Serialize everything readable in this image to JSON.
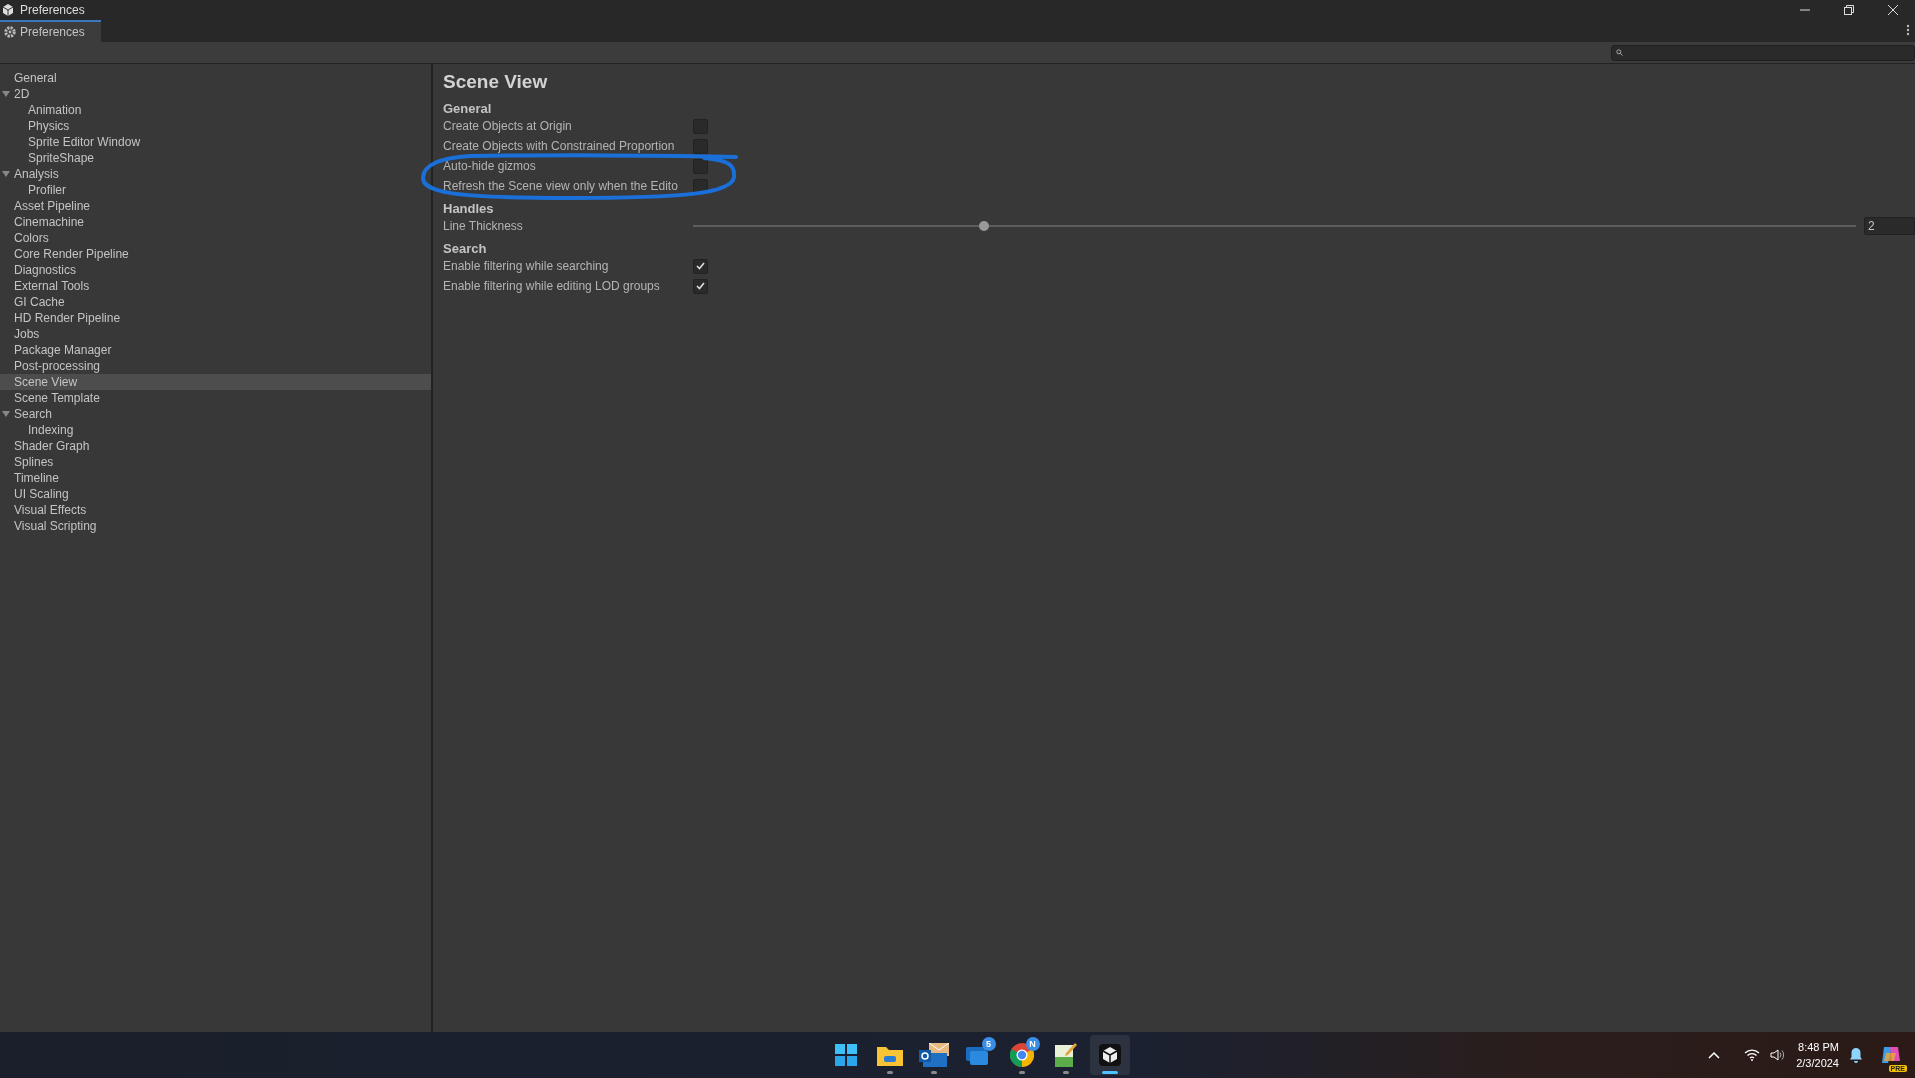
{
  "window": {
    "title": "Preferences"
  },
  "tab": {
    "label": "Preferences",
    "selected": true
  },
  "sidebar": {
    "items": [
      {
        "label": "General",
        "selected": false
      },
      {
        "label": "2D",
        "selected": false,
        "expanded": true,
        "children": [
          {
            "label": "Animation",
            "selected": false
          },
          {
            "label": "Physics",
            "selected": false
          },
          {
            "label": "Sprite Editor Window",
            "selected": false
          },
          {
            "label": "SpriteShape",
            "selected": false
          }
        ]
      },
      {
        "label": "Analysis",
        "selected": false,
        "expanded": true,
        "children": [
          {
            "label": "Profiler",
            "selected": false
          }
        ]
      },
      {
        "label": "Asset Pipeline",
        "selected": false
      },
      {
        "label": "Cinemachine",
        "selected": false
      },
      {
        "label": "Colors",
        "selected": false
      },
      {
        "label": "Core Render Pipeline",
        "selected": false
      },
      {
        "label": "Diagnostics",
        "selected": false
      },
      {
        "label": "External Tools",
        "selected": false
      },
      {
        "label": "GI Cache",
        "selected": false
      },
      {
        "label": "HD Render Pipeline",
        "selected": false
      },
      {
        "label": "Jobs",
        "selected": false
      },
      {
        "label": "Package Manager",
        "selected": false
      },
      {
        "label": "Post-processing",
        "selected": false
      },
      {
        "label": "Scene View",
        "selected": true
      },
      {
        "label": "Scene Template",
        "selected": false
      },
      {
        "label": "Search",
        "selected": false,
        "expanded": true,
        "children": [
          {
            "label": "Indexing",
            "selected": false
          }
        ]
      },
      {
        "label": "Shader Graph",
        "selected": false
      },
      {
        "label": "Splines",
        "selected": false
      },
      {
        "label": "Timeline",
        "selected": false
      },
      {
        "label": "UI Scaling",
        "selected": false
      },
      {
        "label": "Visual Effects",
        "selected": false
      },
      {
        "label": "Visual Scripting",
        "selected": false
      }
    ]
  },
  "content": {
    "title": "Scene View",
    "sections": [
      {
        "heading": "General",
        "settings": [
          {
            "kind": "checkbox",
            "label": "Create Objects at Origin",
            "checked": false
          },
          {
            "kind": "checkbox",
            "label": "Create Objects with Constrained Proportion",
            "checked": false
          },
          {
            "kind": "checkbox",
            "label": "Auto-hide gizmos",
            "checked": false
          },
          {
            "kind": "checkbox",
            "label": "Refresh the Scene view only when the Edito",
            "checked": false
          }
        ]
      },
      {
        "heading": "Handles",
        "settings": [
          {
            "kind": "slider",
            "label": "Line Thickness",
            "level": 0.25,
            "reading": "2"
          }
        ]
      },
      {
        "heading": "Search",
        "settings": [
          {
            "kind": "checkbox",
            "label": "Enable filtering while searching",
            "checked": true
          },
          {
            "kind": "checkbox",
            "label": "Enable filtering while editing LOD groups",
            "checked": true
          }
        ]
      }
    ]
  },
  "taskbar": {
    "apps": [
      {
        "kind": "start",
        "running": false,
        "selected": false
      },
      {
        "kind": "folder",
        "running": true,
        "selected": false
      },
      {
        "kind": "mail",
        "running": true,
        "selected": false
      },
      {
        "kind": "chat",
        "running": false,
        "selected": false,
        "badge": "5"
      },
      {
        "kind": "browser",
        "running": true,
        "selected": false,
        "badge": "N"
      },
      {
        "kind": "notepad",
        "running": true,
        "selected": false
      },
      {
        "kind": "unity",
        "running": true,
        "selected": true
      }
    ],
    "time": "8:48 PM",
    "date": "2/3/2024",
    "assistant_badge": "PRE"
  }
}
